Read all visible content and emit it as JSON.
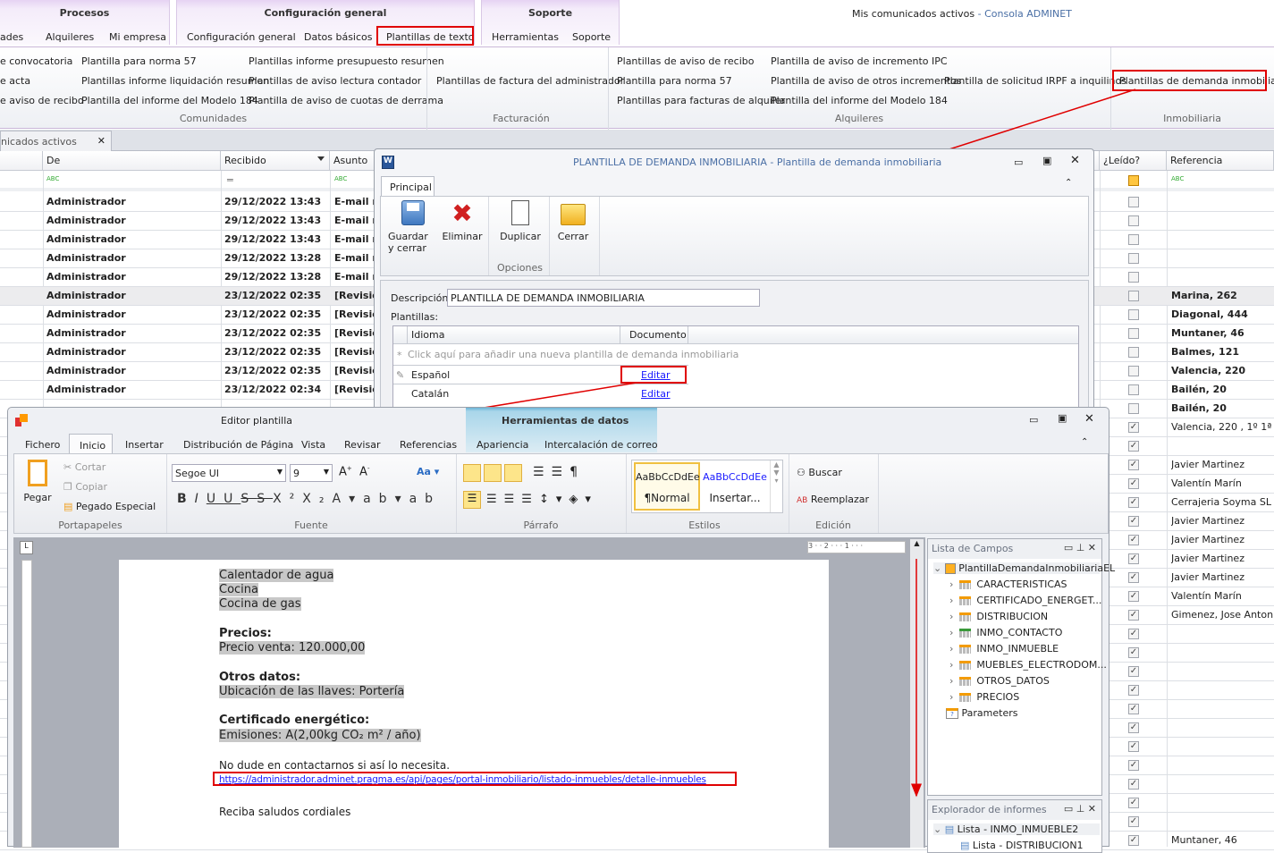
{
  "window_title": {
    "main": "Mis comunicados activos",
    "sep": " - ",
    "app": "Consola ADMINET"
  },
  "ribbon": {
    "groups": [
      "Procesos",
      "Configuración general",
      "Soporte"
    ],
    "tabs": [
      "ades",
      "Alquileres",
      "Mi empresa",
      "Configuración general",
      "Datos básicos",
      "Plantillas de texto",
      "Herramientas",
      "Soporte"
    ],
    "comunidades": {
      "label": "Comunidades",
      "col1": [
        "e convocatoria",
        "e acta",
        "e aviso de recibo"
      ],
      "col2": [
        "Plantilla para norma 57",
        "Plantillas informe liquidación resumen",
        "Plantilla del informe del Modelo 184"
      ],
      "col3": [
        "Plantillas informe presupuesto resumen",
        "Plantillas de aviso lectura contador",
        "Plantilla de aviso de cuotas de derrama"
      ]
    },
    "facturacion": {
      "label": "Facturación",
      "items": [
        "Plantillas de factura del administrador"
      ]
    },
    "alquileres": {
      "label": "Alquileres",
      "col1": [
        "Plantillas de aviso de recibo",
        "Plantilla para norma 57",
        "Plantillas para facturas de alquiler"
      ],
      "col2": [
        "Plantilla de aviso de incremento IPC",
        "Plantilla de aviso de otros incrementos",
        "Plantilla del informe del Modelo 184"
      ],
      "col3": [
        "Plantilla de solicitud IRPF a inquilinos"
      ]
    },
    "inmobiliaria": {
      "label": "Inmobiliaria",
      "items": [
        "Plantillas de demanda inmobiliaria"
      ]
    }
  },
  "doc_tab": {
    "label": "nicados activos",
    "close": "✕"
  },
  "grid": {
    "headers": {
      "de": "De",
      "recibido": "Recibido",
      "asunto": "Asunto",
      "leido": "¿Leído?",
      "referencia": "Referencia"
    },
    "filter_abc": "ABC",
    "filter_eq": "═",
    "rows": [
      {
        "de": "Administrador",
        "recibido": "29/12/2022 13:43",
        "asunto": "E-mail n",
        "leido": false,
        "ref": "",
        "bold": true
      },
      {
        "de": "Administrador",
        "recibido": "29/12/2022 13:43",
        "asunto": "E-mail n",
        "leido": false,
        "ref": "",
        "bold": true
      },
      {
        "de": "Administrador",
        "recibido": "29/12/2022 13:43",
        "asunto": "E-mail n",
        "leido": false,
        "ref": "",
        "bold": true
      },
      {
        "de": "Administrador",
        "recibido": "29/12/2022 13:28",
        "asunto": "E-mail n",
        "leido": false,
        "ref": "",
        "bold": true
      },
      {
        "de": "Administrador",
        "recibido": "29/12/2022 13:28",
        "asunto": "E-mail n",
        "leido": false,
        "ref": "",
        "bold": true
      },
      {
        "de": "Administrador",
        "recibido": "23/12/2022 02:35",
        "asunto": "[Revisió",
        "leido": false,
        "ref": "Marina, 262",
        "bold": true
      },
      {
        "de": "Administrador",
        "recibido": "23/12/2022 02:35",
        "asunto": "[Revisió",
        "leido": false,
        "ref": "Diagonal, 444",
        "bold": true
      },
      {
        "de": "Administrador",
        "recibido": "23/12/2022 02:35",
        "asunto": "[Revisió",
        "leido": false,
        "ref": "Muntaner, 46",
        "bold": true
      },
      {
        "de": "Administrador",
        "recibido": "23/12/2022 02:35",
        "asunto": "[Revisió",
        "leido": false,
        "ref": "Balmes, 121",
        "bold": true
      },
      {
        "de": "Administrador",
        "recibido": "23/12/2022 02:35",
        "asunto": "[Revisió",
        "leido": false,
        "ref": "Valencia, 220",
        "bold": true
      },
      {
        "de": "Administrador",
        "recibido": "23/12/2022 02:34",
        "asunto": "[Revisió",
        "leido": false,
        "ref": "Bailén, 20",
        "bold": true
      },
      {
        "de": "",
        "recibido": "",
        "asunto": "",
        "leido": false,
        "ref": "Bailén, 20",
        "bold": true
      },
      {
        "de": "",
        "recibido": "",
        "asunto": "",
        "leido": true,
        "ref": "Valencia, 220 , 1º 1ª",
        "bold": false
      },
      {
        "de": "",
        "recibido": "",
        "asunto": "",
        "leido": true,
        "ref": "",
        "bold": false
      },
      {
        "de": "",
        "recibido": "",
        "asunto": "",
        "leido": true,
        "ref": "Javier Martinez",
        "bold": false
      },
      {
        "de": "",
        "recibido": "",
        "asunto": "",
        "leido": true,
        "ref": "Valentín Marín",
        "bold": false
      },
      {
        "de": "",
        "recibido": "",
        "asunto": "",
        "leido": true,
        "ref": "Cerrajeria Soyma SL",
        "bold": false
      },
      {
        "de": "",
        "recibido": "",
        "asunto": "",
        "leido": true,
        "ref": "Javier Martinez",
        "bold": false
      },
      {
        "de": "",
        "recibido": "",
        "asunto": "",
        "leido": true,
        "ref": "Javier Martinez",
        "bold": false
      },
      {
        "de": "",
        "recibido": "",
        "asunto": "",
        "leido": true,
        "ref": "Javier Martinez",
        "bold": false
      },
      {
        "de": "",
        "recibido": "",
        "asunto": "",
        "leido": true,
        "ref": "Javier Martinez",
        "bold": false
      },
      {
        "de": "",
        "recibido": "",
        "asunto": "",
        "leido": true,
        "ref": "Valentín Marín",
        "bold": false
      },
      {
        "de": "",
        "recibido": "",
        "asunto": "",
        "leido": true,
        "ref": "Gimenez, Jose Antonio",
        "bold": false
      },
      {
        "de": "",
        "recibido": "",
        "asunto": "",
        "leido": true,
        "ref": "",
        "bold": false
      },
      {
        "de": "",
        "recibido": "",
        "asunto": "",
        "leido": true,
        "ref": "",
        "bold": false
      },
      {
        "de": "",
        "recibido": "",
        "asunto": "",
        "leido": true,
        "ref": "",
        "bold": false
      },
      {
        "de": "",
        "recibido": "",
        "asunto": "",
        "leido": true,
        "ref": "",
        "bold": false
      },
      {
        "de": "",
        "recibido": "",
        "asunto": "",
        "leido": true,
        "ref": "",
        "bold": false
      },
      {
        "de": "",
        "recibido": "",
        "asunto": "",
        "leido": true,
        "ref": "",
        "bold": false
      },
      {
        "de": "",
        "recibido": "",
        "asunto": "",
        "leido": true,
        "ref": "",
        "bold": false
      },
      {
        "de": "",
        "recibido": "",
        "asunto": "",
        "leido": true,
        "ref": "",
        "bold": false
      },
      {
        "de": "",
        "recibido": "",
        "asunto": "",
        "leido": true,
        "ref": "",
        "bold": false
      },
      {
        "de": "",
        "recibido": "",
        "asunto": "",
        "leido": true,
        "ref": "",
        "bold": false
      },
      {
        "de": "",
        "recibido": "",
        "asunto": "",
        "leido": true,
        "ref": "",
        "bold": false
      },
      {
        "de": "",
        "recibido": "",
        "asunto": "",
        "leido": true,
        "ref": "Muntaner, 46",
        "bold": false
      }
    ]
  },
  "dialog": {
    "title": "PLANTILLA DE DEMANDA INMOBILIARIA - Plantilla de demanda inmobiliaria",
    "tab": "Principal",
    "buttons": {
      "save": "Guardar y cerrar",
      "delete": "Eliminar",
      "duplicate": "Duplicar",
      "close": "Cerrar"
    },
    "group_label": "Opciones",
    "desc_label": "Descripción:",
    "desc_value": "PLANTILLA DE DEMANDA INMOBILIARIA",
    "plantillas_label": "Plantillas:",
    "cols": {
      "idioma": "Idioma",
      "documento": "Documento"
    },
    "new_row": "Click aquí para añadir una nueva plantilla de demanda inmobiliaria",
    "rows": [
      {
        "idioma": "Español",
        "doc": "Editar"
      },
      {
        "idioma": "Catalán",
        "doc": "Editar"
      }
    ]
  },
  "editor": {
    "title": "Editor plantilla",
    "context": "Herramientas de datos",
    "tabs": [
      "Fichero",
      "Inicio",
      "Insertar",
      "Distribución de Página",
      "Vista",
      "Revisar",
      "Referencias",
      "Apariencia",
      "Intercalación de correo"
    ],
    "clip": {
      "paste": "Pegar",
      "cut": "Cortar",
      "copy": "Copiar",
      "special": "Pegado Especial",
      "label": "Portapapeles"
    },
    "font": {
      "name": "Segoe UI",
      "size": "9",
      "label": "Fuente"
    },
    "para_label": "Párrafo",
    "styles": {
      "s1": "AaBbCcDdEe",
      "n1": "¶Normal",
      "s2": "AaBbCcDdEe",
      "n2": "Insertar...",
      "label": "Estilos"
    },
    "edit": {
      "find": "Buscar",
      "replace": "Reemplazar",
      "label": "Edición"
    },
    "doc": {
      "l1": "Calentador de agua",
      "l2": "Cocina",
      "l3": "Cocina de gas",
      "h1": "Precios:",
      "p1": "Precio venta: 120.000,00",
      "h2": "Otros datos:",
      "p2": "Ubicación de las llaves: Portería",
      "h3": "Certificado energético:",
      "p3": "Emisiones: A(2,00kg CO₂ m² / año)",
      "contact": "No dude en contactarnos si así lo necesita.",
      "link": "https://administrador.adminet.pragma.es/api/pages/portal-inmobiliario/listado-inmuebles/detalle-inmuebles",
      "bye": "Reciba saludos cordiales"
    },
    "fields": {
      "title": "Lista de Campos",
      "root": "PlantillaDemandaInmobiliariaEL",
      "items": [
        "CARACTERISTICAS",
        "CERTIFICADO_ENERGET...",
        "DISTRIBUCION",
        "INMO_CONTACTO",
        "INMO_INMUEBLE",
        "MUEBLES_ELECTRODOM...",
        "OTROS_DATOS",
        "PRECIOS"
      ],
      "params": "Parameters"
    },
    "explorer": {
      "title": "Explorador de informes",
      "i1": "Lista - INMO_INMUEBLE2",
      "i2": "Lista - DISTRIBUCION1"
    }
  },
  "colors": {
    "accent": "#e00000",
    "link": "#1a1aff",
    "title_blue": "#4a6fa5"
  }
}
